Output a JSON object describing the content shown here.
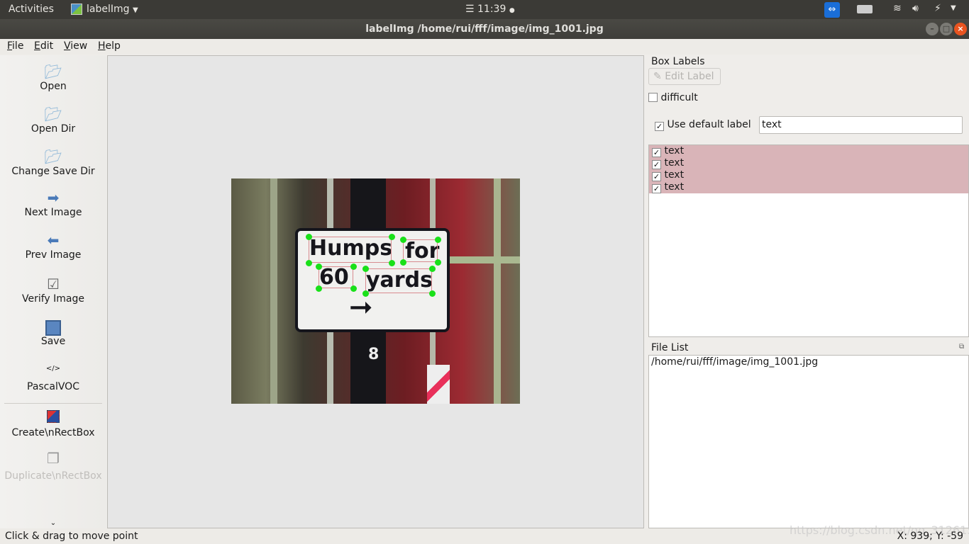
{
  "topbar": {
    "activities": "Activities",
    "app_name": "labelImg",
    "clock": "11:39"
  },
  "window": {
    "title": "labelImg /home/rui/fff/image/img_1001.jpg"
  },
  "menu": [
    {
      "label": "File",
      "mnemonic": "F",
      "rest": "ile"
    },
    {
      "label": "Edit",
      "mnemonic": "E",
      "rest": "dit"
    },
    {
      "label": "View",
      "mnemonic": "V",
      "rest": "iew"
    },
    {
      "label": "Help",
      "mnemonic": "H",
      "rest": "elp"
    }
  ],
  "toolbar": {
    "items": [
      {
        "label": "Open",
        "icon": "folder-icon"
      },
      {
        "label": "Open Dir",
        "icon": "folder-icon"
      },
      {
        "label": "Change Save Dir",
        "icon": "folder-icon"
      },
      {
        "label": "Next Image",
        "icon": "arrow-right-icon"
      },
      {
        "label": "Prev Image",
        "icon": "arrow-left-icon"
      },
      {
        "label": "Verify Image",
        "icon": "checkbox-icon"
      },
      {
        "label": "Save",
        "icon": "floppy-icon"
      },
      {
        "label": "PascalVOC",
        "icon": "</>"
      },
      {
        "label": "Create\\nRectBox",
        "icon": "create-rect-icon"
      },
      {
        "label": "Duplicate\\nRectBox",
        "icon": "duplicate-icon",
        "disabled": true
      }
    ]
  },
  "image": {
    "sign_words": [
      "Humps",
      "for",
      "60",
      "yards"
    ],
    "pole_number": "8"
  },
  "dock": {
    "box_labels_title": "Box Labels",
    "edit_label": "Edit Label",
    "difficult": "difficult",
    "use_default_label": "Use default label",
    "default_label_value": "text",
    "labels": [
      "text",
      "text",
      "text",
      "text"
    ],
    "file_list_title": "File List",
    "files": [
      "/home/rui/fff/image/img_1001.jpg"
    ]
  },
  "status": {
    "message": "Click & drag to move point",
    "coords": "X: 939; Y: -59",
    "watermark": "https://blog.csdn.net/qq_31261509"
  },
  "colors": {
    "label_highlight": "#d9b4b8",
    "point": "#19e019",
    "box": "#d88b8f",
    "close_button": "#e95420"
  }
}
